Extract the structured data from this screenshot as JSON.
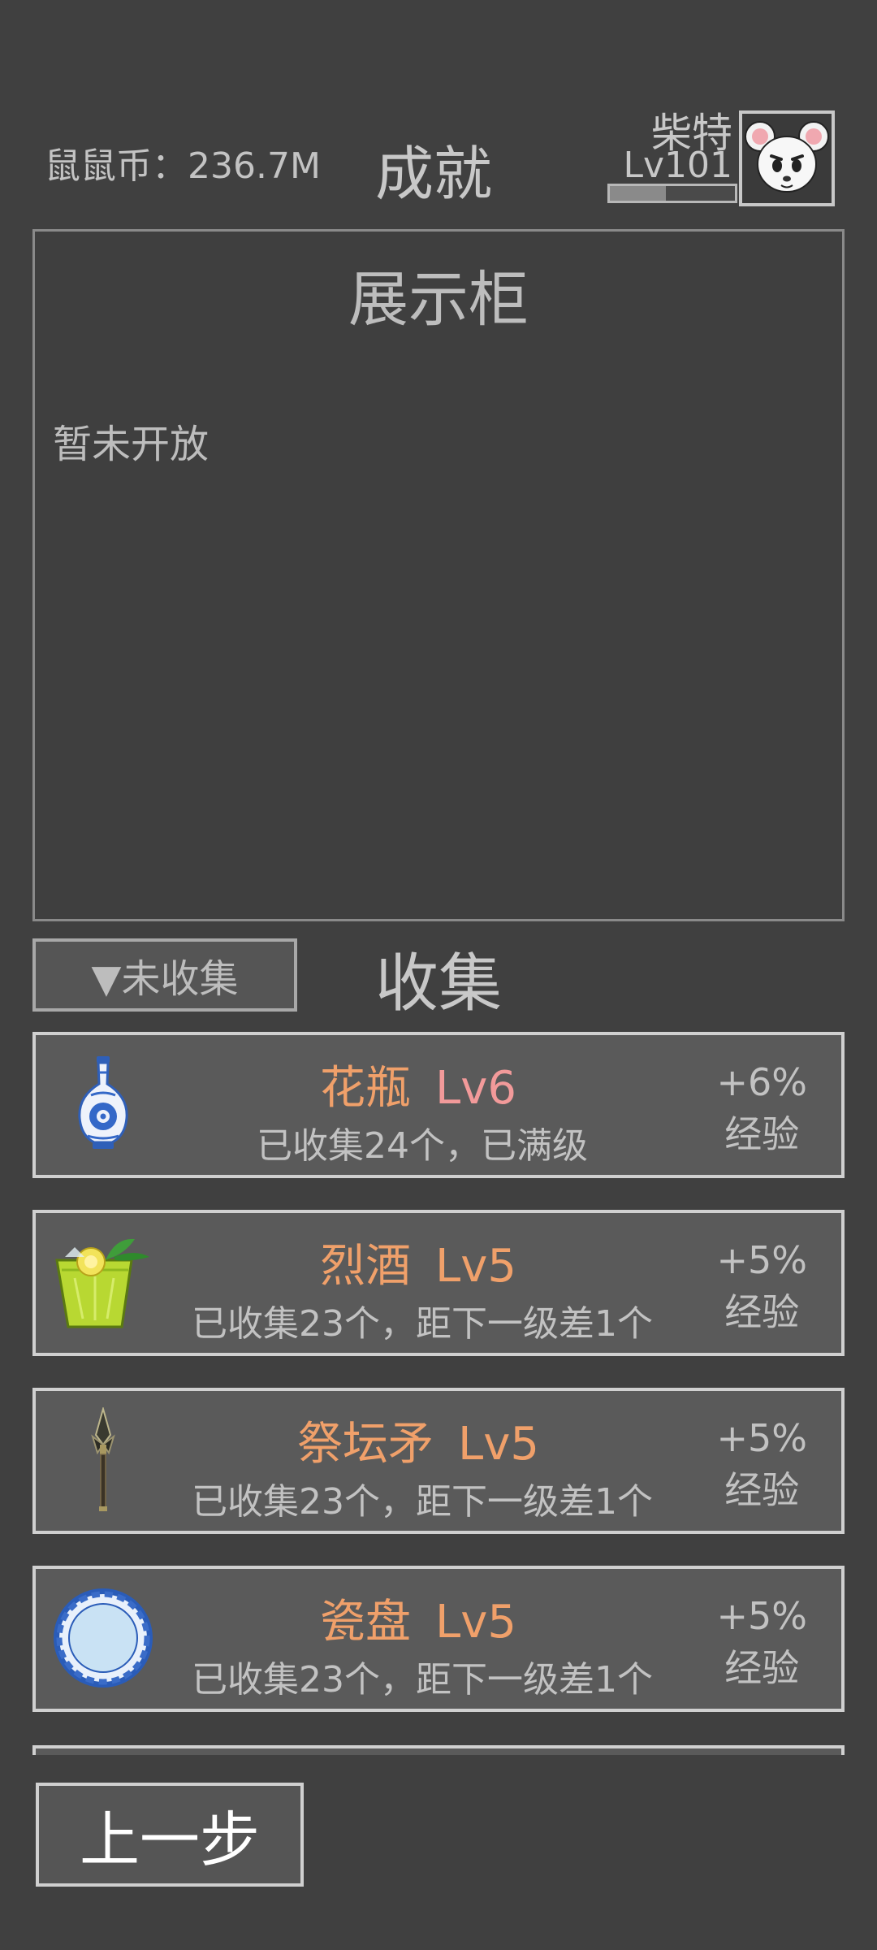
{
  "header": {
    "coins_label": "鼠鼠币：236.7M",
    "title": "成就",
    "player": {
      "name": "柴特",
      "level": "Lv101",
      "exp_progress": 0.45
    }
  },
  "cabinet": {
    "title": "展示柜",
    "message": "暂未开放"
  },
  "collection": {
    "filter_label": "▼未收集",
    "title": "收集",
    "items": [
      {
        "name": "花瓶",
        "level": "Lv6",
        "status": "已收集24个，已满级",
        "bonus_value": "+6%",
        "bonus_type": "经验",
        "icon": "vase-icon"
      },
      {
        "name": "烈酒",
        "level": "Lv5",
        "status": "已收集23个，距下一级差1个",
        "bonus_value": "+5%",
        "bonus_type": "经验",
        "icon": "drink-icon"
      },
      {
        "name": "祭坛矛",
        "level": "Lv5",
        "status": "已收集23个，距下一级差1个",
        "bonus_value": "+5%",
        "bonus_type": "经验",
        "icon": "spear-icon"
      },
      {
        "name": "瓷盘",
        "level": "Lv5",
        "status": "已收集23个，距下一级差1个",
        "bonus_value": "+5%",
        "bonus_type": "经验",
        "icon": "plate-icon"
      }
    ]
  },
  "footer": {
    "back_label": "上一步"
  },
  "colors": {
    "background": "#404040",
    "item_name": "#f0a06a",
    "max_level": "#f29a9a"
  }
}
